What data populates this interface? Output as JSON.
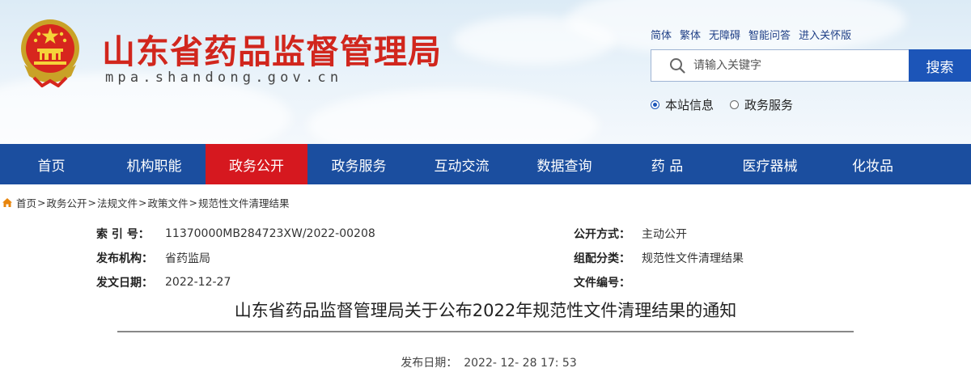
{
  "header": {
    "site_title": "山东省药品监督管理局",
    "site_domain": "mpa.shandong.gov.cn",
    "brand_color": "#d1261d",
    "emblem_icon": "national-emblem-icon"
  },
  "toplinks": [
    "简体",
    "繁体",
    "无障碍",
    "智能问答",
    "进入关怀版"
  ],
  "search": {
    "placeholder": "请输入关键字",
    "button_label": "搜索",
    "button_color": "#1c55b8",
    "icon": "search-icon"
  },
  "scope": {
    "options": [
      "本站信息",
      "政务服务"
    ],
    "selected": "本站信息"
  },
  "nav": {
    "background": "#1b4e9f",
    "active_color": "#d6181f",
    "items": [
      "首页",
      "机构职能",
      "政务公开",
      "政务服务",
      "互动交流",
      "数据查询",
      "药 品",
      "医疗器械",
      "化妆品"
    ],
    "active": "政务公开"
  },
  "breadcrumb": {
    "icon": "home-icon",
    "items": [
      "首页",
      "政务公开",
      "法规文件",
      "政策文件",
      "规范性文件清理结果"
    ],
    "separator": ">"
  },
  "meta": {
    "left": [
      {
        "key": "索 引 号：",
        "value": "11370000MB284723XW/2022-00208"
      },
      {
        "key": "发布机构：",
        "value": "省药监局"
      },
      {
        "key": "发文日期：",
        "value": "2022-12-27"
      }
    ],
    "right": [
      {
        "key": "公开方式：",
        "value": "主动公开"
      },
      {
        "key": "组配分类：",
        "value": "规范性文件清理结果"
      },
      {
        "key": "文件编号：",
        "value": ""
      }
    ]
  },
  "document": {
    "title": "山东省药品监督管理局关于公布2022年规范性文件清理结果的通知",
    "publish_label": "发布日期：",
    "publish_value": "2022- 12- 28 17: 53"
  }
}
